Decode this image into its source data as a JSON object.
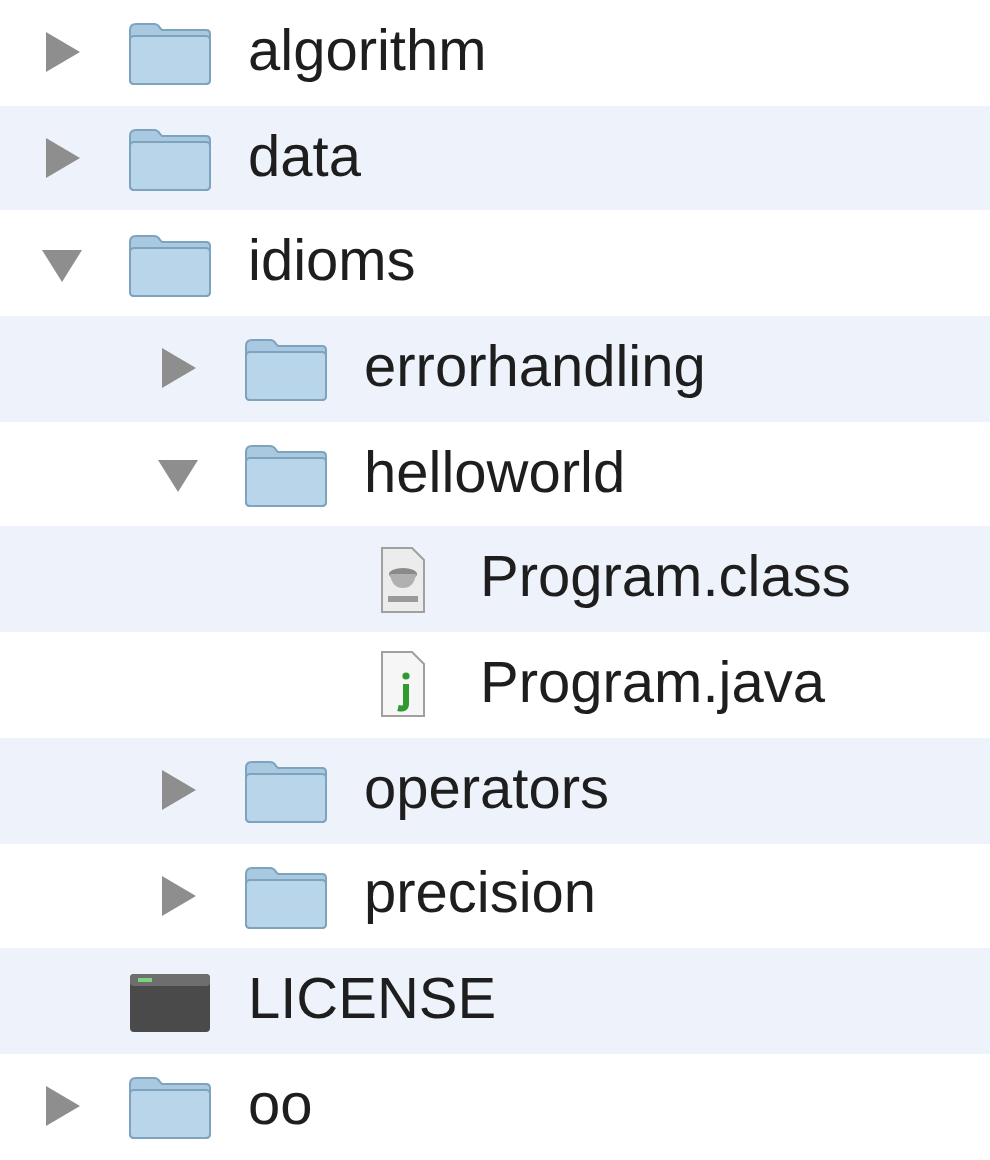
{
  "tree": [
    {
      "kind": "folder",
      "name": "algorithm",
      "expanded": false
    },
    {
      "kind": "folder",
      "name": "data",
      "expanded": false
    },
    {
      "kind": "folder",
      "name": "idioms",
      "expanded": true,
      "children": [
        {
          "kind": "folder",
          "name": "errorhandling",
          "expanded": false
        },
        {
          "kind": "folder",
          "name": "helloworld",
          "expanded": true,
          "children": [
            {
              "kind": "class",
              "name": "Program.class"
            },
            {
              "kind": "java",
              "name": "Program.java"
            }
          ]
        },
        {
          "kind": "folder",
          "name": "operators",
          "expanded": false
        },
        {
          "kind": "folder",
          "name": "precision",
          "expanded": false
        }
      ]
    },
    {
      "kind": "executable",
      "name": "LICENSE"
    },
    {
      "kind": "folder",
      "name": "oo",
      "expanded": false
    }
  ]
}
